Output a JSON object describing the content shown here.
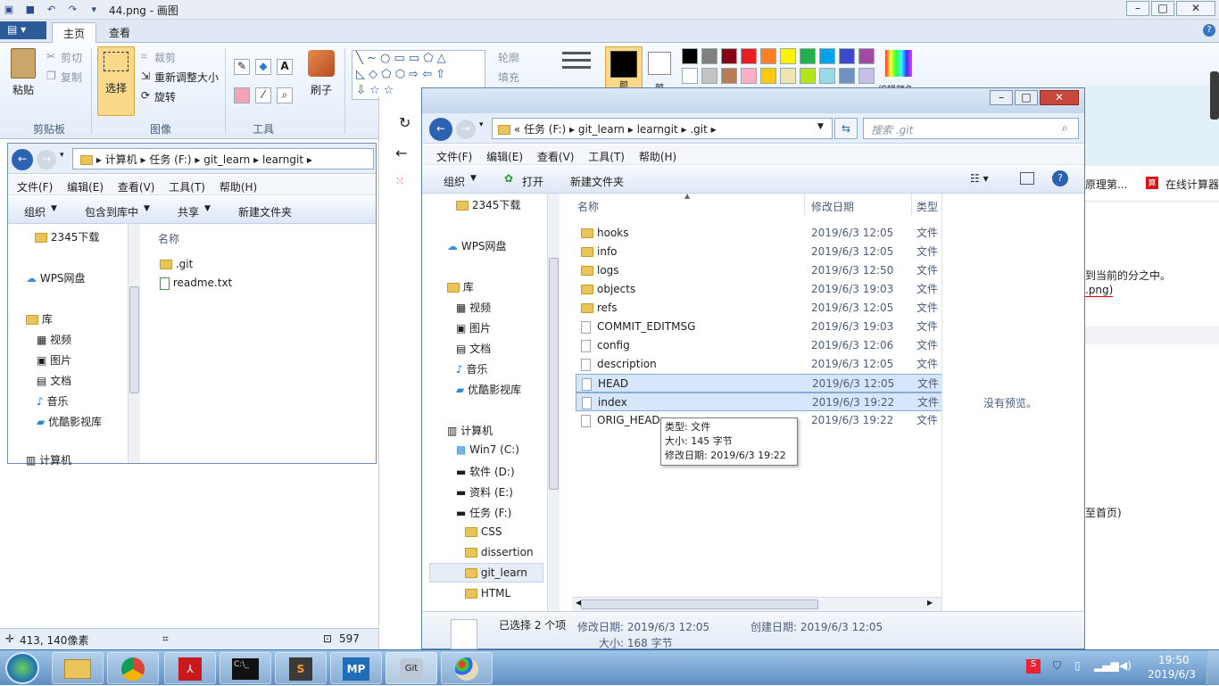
{
  "paint": {
    "title": "44.png - 画图",
    "tabs": [
      "主页",
      "查看"
    ],
    "clipboard": {
      "paste": "粘贴",
      "cut": "剪切",
      "copy": "复制",
      "group": "剪贴板"
    },
    "image": {
      "select": "选择",
      "crop": "裁剪",
      "resize": "重新调整大小",
      "rotate": "旋转",
      "group": "图像"
    },
    "tools": {
      "group": "工具",
      "brush": "刷子"
    },
    "shapes": {
      "outline": "轮廓",
      "fill": "填充"
    },
    "colors": {
      "color1": "颜",
      "color2": "颜",
      "edit": "编辑颜色"
    },
    "status": {
      "pos": "413, 140像素",
      "size": "597"
    },
    "palette_row1": [
      "#000000",
      "#7f7f7f",
      "#880015",
      "#ed1c24",
      "#ff7f27",
      "#fff200",
      "#22b14c",
      "#00a2e8",
      "#3f48cc",
      "#a349a4"
    ],
    "palette_row2": [
      "#ffffff",
      "#c3c3c3",
      "#b97a57",
      "#ffaec9",
      "#ffc90e",
      "#efe4b0",
      "#b5e61d",
      "#99d9ea",
      "#7092be",
      "#c8bfe7"
    ]
  },
  "explorer1": {
    "path": [
      "计算机",
      "任务 (F:)",
      "git_learn",
      "learngit"
    ],
    "menu": [
      "文件(F)",
      "编辑(E)",
      "查看(V)",
      "工具(T)",
      "帮助(H)"
    ],
    "cmds": [
      "组织",
      "包含到库中",
      "共享",
      "新建文件夹"
    ],
    "nav": [
      "2345下载",
      "WPS网盘",
      "库",
      "视频",
      "图片",
      "文档",
      "音乐",
      "优酷影视库",
      "计算机"
    ],
    "col_name": "名称",
    "files": [
      ".git",
      "readme.txt"
    ]
  },
  "explorer2": {
    "path": [
      "任务 (F:)",
      "git_learn",
      "learngit",
      ".git"
    ],
    "search_placeholder": "搜索 .git",
    "menu": [
      "文件(F)",
      "编辑(E)",
      "查看(V)",
      "工具(T)",
      "帮助(H)"
    ],
    "cmds": [
      "组织",
      "打开",
      "新建文件夹"
    ],
    "nav": [
      "2345下载",
      "WPS网盘",
      "库",
      "视频",
      "图片",
      "文档",
      "音乐",
      "优酷影视库",
      "计算机",
      "Win7 (C:)",
      "软件 (D:)",
      "资料 (E:)",
      "任务 (F:)",
      "CSS",
      "dissertion",
      "git_learn",
      "HTML"
    ],
    "cols": {
      "name": "名称",
      "date": "修改日期",
      "type": "类型"
    },
    "files": [
      {
        "name": "hooks",
        "date": "2019/6/3 12:05",
        "type": "文件",
        "kind": "folder"
      },
      {
        "name": "info",
        "date": "2019/6/3 12:05",
        "type": "文件",
        "kind": "folder"
      },
      {
        "name": "logs",
        "date": "2019/6/3 12:50",
        "type": "文件",
        "kind": "folder"
      },
      {
        "name": "objects",
        "date": "2019/6/3 19:03",
        "type": "文件",
        "kind": "folder"
      },
      {
        "name": "refs",
        "date": "2019/6/3 12:05",
        "type": "文件",
        "kind": "folder"
      },
      {
        "name": "COMMIT_EDITMSG",
        "date": "2019/6/3 19:03",
        "type": "文件",
        "kind": "file"
      },
      {
        "name": "config",
        "date": "2019/6/3 12:06",
        "type": "文件",
        "kind": "file"
      },
      {
        "name": "description",
        "date": "2019/6/3 12:05",
        "type": "文件",
        "kind": "file"
      },
      {
        "name": "HEAD",
        "date": "2019/6/3 12:05",
        "type": "文件",
        "kind": "file",
        "selected": true
      },
      {
        "name": "index",
        "date": "2019/6/3 19:22",
        "type": "文件",
        "kind": "file",
        "selected": true
      },
      {
        "name": "ORIG_HEAD",
        "date": "2019/6/3 19:22",
        "type": "文件",
        "kind": "file"
      }
    ],
    "preview": "没有预览。",
    "tooltip": [
      "类型: 文件",
      "大小: 145 字节",
      "修改日期: 2019/6/3 19:22"
    ],
    "details": {
      "selected": "已选择 2 个项",
      "modified": "修改日期: 2019/6/3 12:05",
      "created": "创建日期: 2019/6/3 12:05",
      "size": "大小: 168 字节"
    }
  },
  "browser_bg": {
    "bookmarks": [
      "原理第...",
      "在线计算器"
    ],
    "text1": "到当前的分之中。",
    "text2": ".png)",
    "text3": "至首页)"
  },
  "taskbar": {
    "time": "19:50",
    "date": "2019/6/3",
    "apps": [
      "explorer",
      "chrome",
      "pdf",
      "cmd",
      "sublime",
      "mp",
      "git",
      "paint"
    ]
  }
}
